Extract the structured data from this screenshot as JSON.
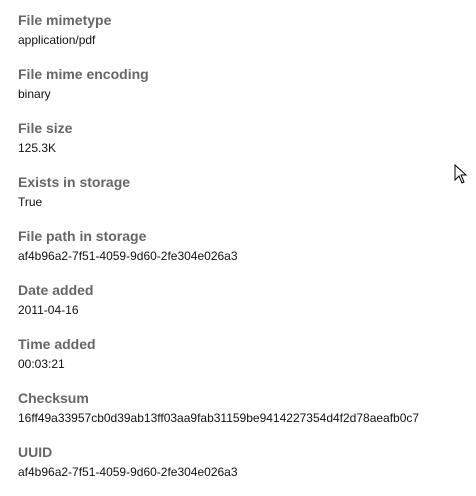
{
  "fields": [
    {
      "label": "File mimetype",
      "value": "application/pdf"
    },
    {
      "label": "File mime encoding",
      "value": "binary"
    },
    {
      "label": "File size",
      "value": "125.3K"
    },
    {
      "label": "Exists in storage",
      "value": "True"
    },
    {
      "label": "File path in storage",
      "value": "af4b96a2-7f51-4059-9d60-2fe304e026a3"
    },
    {
      "label": "Date added",
      "value": "2011-04-16"
    },
    {
      "label": "Time added",
      "value": "00:03:21"
    },
    {
      "label": "Checksum",
      "value": "16ff49a33957cb0d39ab13ff03aa9fab31159be9414227354d4f2d78aeafb0c7"
    },
    {
      "label": "UUID",
      "value": "af4b96a2-7f51-4059-9d60-2fe304e026a3"
    }
  ]
}
